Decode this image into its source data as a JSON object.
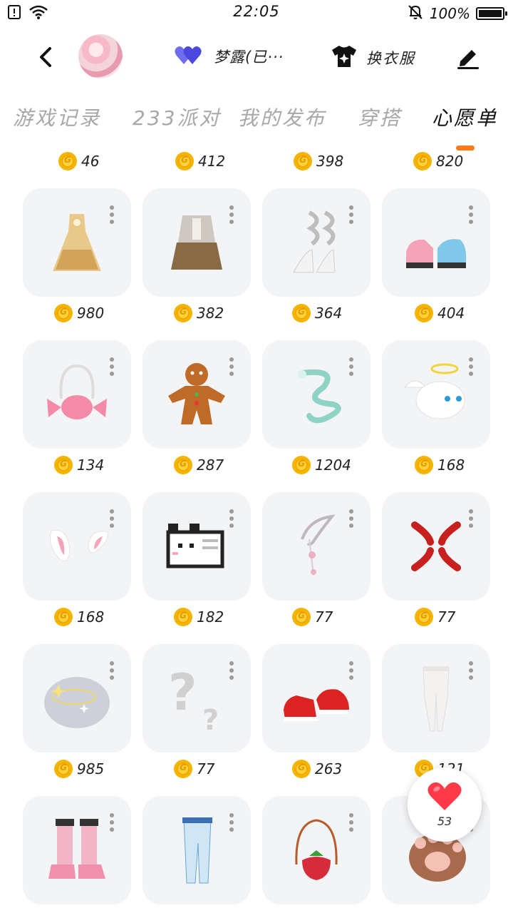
{
  "status_bar": {
    "time": "22:05",
    "battery_text": "100%",
    "battery_level": 1.0
  },
  "header": {
    "match_name": "梦露(已···",
    "wardrobe_label": "换衣服"
  },
  "tabs": [
    {
      "label": "游戏记录",
      "active": false
    },
    {
      "label": "233派对",
      "active": false
    },
    {
      "label": "我的发布",
      "active": false
    },
    {
      "label": "穿搭",
      "active": false
    },
    {
      "label": "心愿单",
      "active": true
    }
  ],
  "top_prices": [
    "46",
    "412",
    "398",
    "820"
  ],
  "items": [
    {
      "price": "980",
      "icon": "golden-dress-icon"
    },
    {
      "price": "382",
      "icon": "brown-outfit-icon"
    },
    {
      "price": "364",
      "icon": "white-heels-icon"
    },
    {
      "price": "404",
      "icon": "pink-blue-shoes-icon"
    },
    {
      "price": "134",
      "icon": "candy-bag-icon"
    },
    {
      "price": "287",
      "icon": "gingerbread-man-icon"
    },
    {
      "price": "1204",
      "icon": "jade-dragon-icon"
    },
    {
      "price": "168",
      "icon": "angel-cat-icon"
    },
    {
      "price": "168",
      "icon": "bunny-ears-icon"
    },
    {
      "price": "182",
      "icon": "pixel-cat-icon"
    },
    {
      "price": "77",
      "icon": "ear-chain-icon"
    },
    {
      "price": "77",
      "icon": "anger-mark-icon"
    },
    {
      "price": "985",
      "icon": "starry-cloud-icon"
    },
    {
      "price": "77",
      "icon": "question-mark-icon"
    },
    {
      "price": "263",
      "icon": "red-sneakers-icon"
    },
    {
      "price": "121",
      "icon": "white-leggings-icon"
    },
    {
      "price": "",
      "icon": "pink-boots-icon"
    },
    {
      "price": "",
      "icon": "blue-pants-icon"
    },
    {
      "price": "",
      "icon": "strawberry-bag-icon"
    },
    {
      "price": "",
      "icon": "paw-glove-icon"
    }
  ],
  "like": {
    "count": "53"
  },
  "colors": {
    "accent": "#ff7a1a",
    "heart": "#ff3b4a",
    "coin": "#f4b400",
    "card_bg": "#f3f4f6",
    "tab_inactive": "#a8a8a8"
  }
}
